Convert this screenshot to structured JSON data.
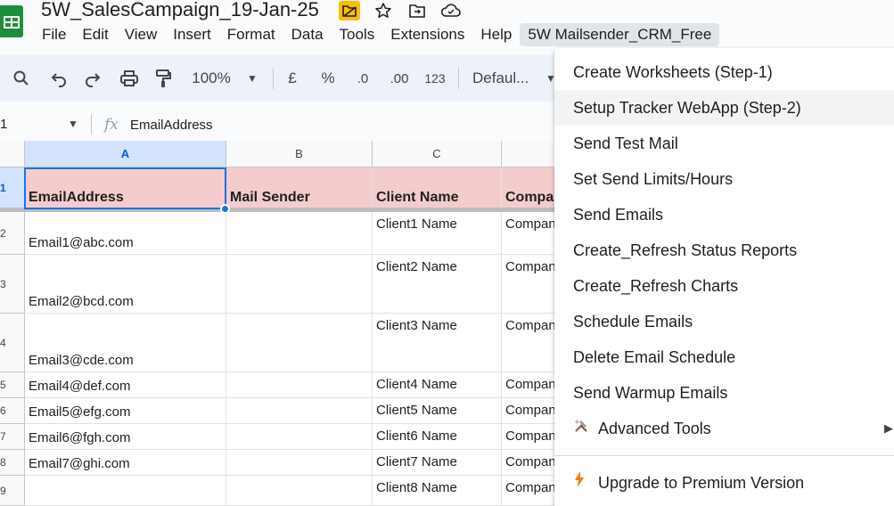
{
  "app": {
    "doc_title": "5W_SalesCampaign_19-Jan-25",
    "title_icons": [
      "folder-shortcut-icon",
      "star-icon",
      "move-folder-icon",
      "cloud-saved-icon"
    ]
  },
  "menubar": {
    "items": [
      "File",
      "Edit",
      "View",
      "Insert",
      "Format",
      "Data",
      "Tools",
      "Extensions",
      "Help",
      "5W Mailsender_CRM_Free"
    ]
  },
  "toolbar": {
    "zoom": "100%",
    "currency": "£",
    "percent": "%",
    "dec_decrease": ".0",
    "dec_increase": ".00",
    "number_format": "123",
    "font": "Defaul..."
  },
  "formula_bar": {
    "cell_ref": "1",
    "fx": "fx",
    "value": "EmailAddress"
  },
  "grid": {
    "columns": [
      "A",
      "B",
      "C"
    ],
    "header_row": [
      "EmailAddress",
      "Mail Sender",
      "Client Name",
      "Compa"
    ],
    "row_numbers": [
      "1",
      "2",
      "3",
      "4",
      "5",
      "6",
      "7",
      "8",
      "9"
    ],
    "rows": [
      {
        "email": "Email1@abc.com",
        "sender": "",
        "client": "Client1 Name",
        "company": "Compan"
      },
      {
        "email": "Email2@bcd.com",
        "sender": "",
        "client": "Client2 Name",
        "company": "Compan"
      },
      {
        "email": "Email3@cde.com",
        "sender": "",
        "client": "Client3 Name",
        "company": "Compan"
      },
      {
        "email": "Email4@def.com",
        "sender": "",
        "client": "Client4 Name",
        "company": "Compan"
      },
      {
        "email": "Email5@efg.com",
        "sender": "",
        "client": "Client5 Name",
        "company": "Compan"
      },
      {
        "email": "Email6@fgh.com",
        "sender": "",
        "client": "Client6 Name",
        "company": "Compan"
      },
      {
        "email": "Email7@ghi.com",
        "sender": "",
        "client": "Client7 Name",
        "company": "Compan"
      },
      {
        "email": "",
        "sender": "",
        "client": "Client8 Name",
        "company": "Compan"
      }
    ]
  },
  "dropdown": {
    "items": [
      "Create Worksheets (Step-1)",
      "Setup Tracker WebApp (Step-2)",
      "Send Test Mail",
      "Set Send Limits/Hours",
      "Send Emails",
      "Create_Refresh Status Reports",
      "Create_Refresh Charts",
      "Schedule Emails",
      "Delete Email Schedule",
      "Send Warmup Emails",
      "Advanced Tools"
    ],
    "upgrade": "Upgrade to Premium Version",
    "colors": {
      "highlight": "#f1f3f4",
      "upgrade_icon": "#f57c00"
    }
  }
}
